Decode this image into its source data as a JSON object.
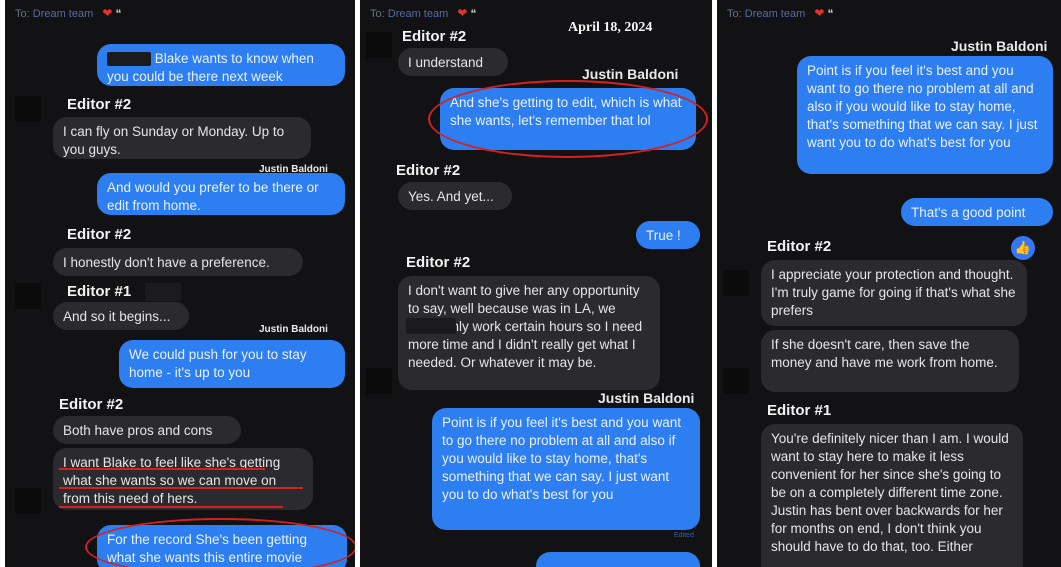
{
  "header": {
    "to_label": "To:",
    "recipient": "Dream team",
    "heart_icon": "heart-icon"
  },
  "panel1": {
    "msg_blake": "Blake wants to know when you could be there next week",
    "editor2_a": "Editor #2",
    "msg_fly": "I can fly on Sunday or Monday. Up to you guys.",
    "justin_a": "Justin Baldoni",
    "msg_prefer": "And would you prefer to be there or edit from home.",
    "editor2_b": "Editor #2",
    "msg_honestly": "I honestly don't have a preference.",
    "editor1_a": "Editor #1",
    "msg_begins": "And so it begins...",
    "justin_b": "Justin Baldoni",
    "msg_push": "We could push for you to stay home - it's up to you",
    "editor2_c": "Editor #2",
    "msg_pros": "Both have pros and cons",
    "msg_want": "I want Blake to feel like she's getting what she wants so we can move on from this need of hers.",
    "msg_record": "For the record She's been getting what she wants this entire movie"
  },
  "panel2": {
    "date": "April 18, 2024",
    "editor2_a": "Editor #2",
    "msg_understand": "I understand",
    "justin_a": "Justin Baldoni",
    "msg_edit": "And she's getting to edit, which is what she wants, let's remember that lol",
    "editor2_b": "Editor #2",
    "msg_yes": "Yes. And yet...",
    "msg_true": "True !",
    "editor2_c": "Editor #2",
    "msg_dontwant": "I don't want to give her any opportunity to say, well because was in LA, we could only work certain hours so I need more time and I didn't really get what I needed. Or whatever it may be.",
    "justin_b": "Justin Baldoni",
    "msg_point": "Point is if you feel it's best and you want to go there no problem at all and also if you would like to stay home, that's something that we can say. I just want you to do what's best for you",
    "status": "Edited"
  },
  "panel3": {
    "justin_a": "Justin Baldoni",
    "msg_point": "Point is if you feel it's best and you want to go there no problem at all and also if you would like to stay home, that's something that we can say. I just want you to do what's best for you",
    "msg_good": "That's a good point",
    "editor2": "Editor #2",
    "msg_appreciate": "I appreciate your protection and thought. I'm truly game for going if that's what she prefers",
    "msg_save": "If she doesn't care, then save the money and have me work from home.",
    "editor1": "Editor #1",
    "msg_nicer": "You're definitely nicer than I am. I would want to stay here to make it less convenient for her since she's going to be on a completely different time zone. Justin has bent over backwards for her for months on end, I don't think you should have to do that, too. Either"
  },
  "colors": {
    "panel_bg": "#121214",
    "blue_bubble": "#2d7ef0",
    "gray_bubble": "#2b2b2f",
    "annotation_red": "#d62020"
  }
}
